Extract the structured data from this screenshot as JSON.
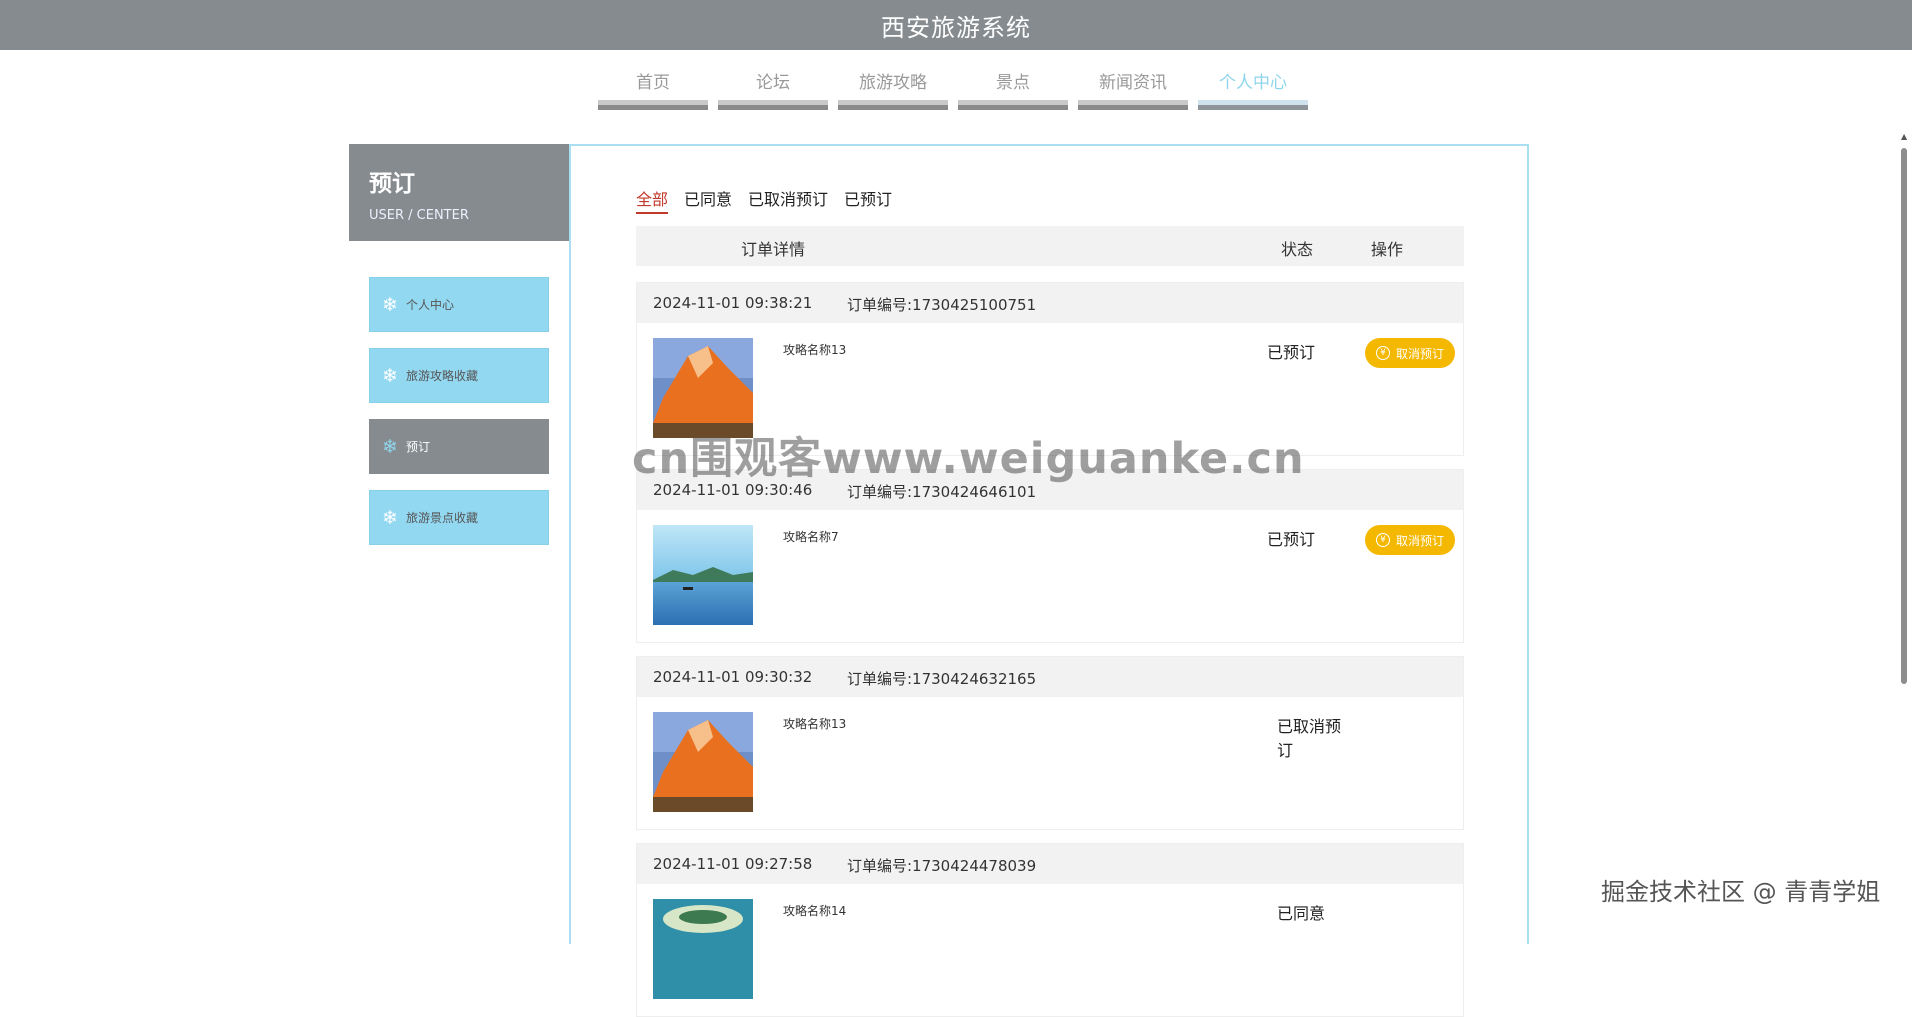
{
  "header": {
    "title": "西安旅游系统"
  },
  "nav": {
    "items": [
      {
        "label": "首页"
      },
      {
        "label": "论坛"
      },
      {
        "label": "旅游攻略"
      },
      {
        "label": "景点"
      },
      {
        "label": "新闻资讯"
      },
      {
        "label": "个人中心"
      }
    ],
    "active_index": 5
  },
  "sidebar": {
    "title": "预订",
    "subtitle": "USER / CENTER",
    "items": [
      {
        "label": "个人中心",
        "icon": "snowflake-icon"
      },
      {
        "label": "旅游攻略收藏",
        "icon": "snowflake-icon"
      },
      {
        "label": "预订",
        "icon": "snowflake-icon"
      },
      {
        "label": "旅游景点收藏",
        "icon": "snowflake-icon"
      }
    ],
    "active_index": 2
  },
  "tabs": [
    {
      "label": "全部"
    },
    {
      "label": "已同意"
    },
    {
      "label": "已取消预订"
    },
    {
      "label": "已预订"
    }
  ],
  "table": {
    "headers": {
      "detail": "订单详情",
      "status": "状态",
      "action": "操作"
    }
  },
  "orders": [
    {
      "time": "2024-11-01 09:38:21",
      "order_no": "订单编号:1730425100751",
      "name": "攻略名称13",
      "status": "已预订",
      "action": "取消预订",
      "image": "orange-rock"
    },
    {
      "time": "2024-11-01 09:30:46",
      "order_no": "订单编号:1730424646101",
      "name": "攻略名称7",
      "status": "已预订",
      "action": "取消预订",
      "image": "lake"
    },
    {
      "time": "2024-11-01 09:30:32",
      "order_no": "订单编号:1730424632165",
      "name": "攻略名称13",
      "status": "已取消预订",
      "action": "",
      "image": "orange-rock"
    },
    {
      "time": "2024-11-01 09:27:58",
      "order_no": "订单编号:1730424478039",
      "name": "攻略名称14",
      "status": "已同意",
      "action": "",
      "image": "island"
    }
  ],
  "watermark": "cn围观客www.weiguanke.cn",
  "credit": "掘金技术社区 @ 青青学姐",
  "colors": {
    "header_bg": "#868b8f",
    "sidebar_item": "#93d8f1",
    "active_tab": "#c0392b",
    "cancel_button": "#f5b800",
    "panel_border": "#a9dff2"
  }
}
